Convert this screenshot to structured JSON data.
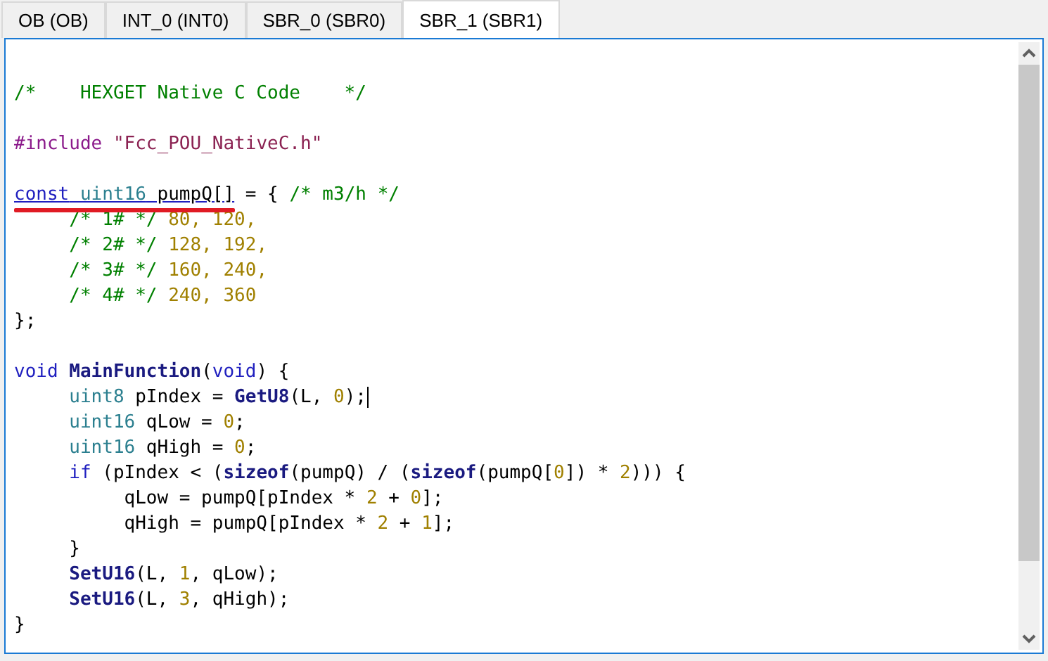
{
  "tabs": [
    {
      "label": "OB (OB)",
      "selected": false
    },
    {
      "label": "INT_0 (INT0)",
      "selected": false
    },
    {
      "label": "SBR_0 (SBR0)",
      "selected": false
    },
    {
      "label": "SBR_1 (SBR1)",
      "selected": true
    }
  ],
  "editor": {
    "lines": [
      {
        "kind": "blank"
      },
      {
        "kind": "code",
        "tokens": [
          {
            "text": "/*    HEXGET Native C Code    */",
            "kind": "comment"
          }
        ]
      },
      {
        "kind": "blank"
      },
      {
        "kind": "code",
        "tokens": [
          {
            "text": "#include",
            "kind": "directive"
          },
          {
            "text": " \"Fcc_POU_NativeC.h\"",
            "kind": "string"
          }
        ]
      },
      {
        "kind": "blank"
      },
      {
        "kind": "code",
        "marked": true,
        "tokens": [
          {
            "text": "const",
            "kind": "keyword",
            "underline": true
          },
          {
            "text": " uint16",
            "kind": "type",
            "underline": true
          },
          {
            "text": " pumpQ[]",
            "kind": "plain",
            "underline": true
          },
          {
            "text": " = {",
            "kind": "plain"
          },
          {
            "text": " /* m3/h */",
            "kind": "comment"
          }
        ]
      },
      {
        "kind": "code",
        "tokens": [
          {
            "text": "     /* 1# */",
            "kind": "comment"
          },
          {
            "text": " 80, 120,",
            "kind": "number"
          }
        ]
      },
      {
        "kind": "code",
        "tokens": [
          {
            "text": "     /* 2# */",
            "kind": "comment"
          },
          {
            "text": " 128, 192,",
            "kind": "number"
          }
        ]
      },
      {
        "kind": "code",
        "tokens": [
          {
            "text": "     /* 3# */",
            "kind": "comment"
          },
          {
            "text": " 160, 240,",
            "kind": "number"
          }
        ]
      },
      {
        "kind": "code",
        "tokens": [
          {
            "text": "     /* 4# */",
            "kind": "comment"
          },
          {
            "text": " 240, 360",
            "kind": "number"
          }
        ]
      },
      {
        "kind": "code",
        "tokens": [
          {
            "text": "};",
            "kind": "plain"
          }
        ]
      },
      {
        "kind": "blank"
      },
      {
        "kind": "code",
        "tokens": [
          {
            "text": "void",
            "kind": "keyword"
          },
          {
            "text": " MainFunction",
            "kind": "function"
          },
          {
            "text": "(",
            "kind": "plain"
          },
          {
            "text": "void",
            "kind": "keyword"
          },
          {
            "text": ") {",
            "kind": "plain"
          }
        ]
      },
      {
        "kind": "code",
        "cursor": true,
        "tokens": [
          {
            "text": "     uint8",
            "kind": "type"
          },
          {
            "text": " pIndex =",
            "kind": "plain"
          },
          {
            "text": " GetU8",
            "kind": "function"
          },
          {
            "text": "(L,",
            "kind": "plain"
          },
          {
            "text": " 0",
            "kind": "number"
          },
          {
            "text": ");",
            "kind": "plain"
          }
        ]
      },
      {
        "kind": "code",
        "tokens": [
          {
            "text": "     uint16",
            "kind": "type"
          },
          {
            "text": " qLow =",
            "kind": "plain"
          },
          {
            "text": " 0",
            "kind": "number"
          },
          {
            "text": ";",
            "kind": "plain"
          }
        ]
      },
      {
        "kind": "code",
        "tokens": [
          {
            "text": "     uint16",
            "kind": "type"
          },
          {
            "text": " qHigh =",
            "kind": "plain"
          },
          {
            "text": " 0",
            "kind": "number"
          },
          {
            "text": ";",
            "kind": "plain"
          }
        ]
      },
      {
        "kind": "code",
        "tokens": [
          {
            "text": "     if",
            "kind": "keyword"
          },
          {
            "text": " (pIndex < (",
            "kind": "plain"
          },
          {
            "text": "sizeof",
            "kind": "function"
          },
          {
            "text": "(pumpQ) / (",
            "kind": "plain"
          },
          {
            "text": "sizeof",
            "kind": "function"
          },
          {
            "text": "(pumpQ[",
            "kind": "plain"
          },
          {
            "text": "0",
            "kind": "number"
          },
          {
            "text": "]) *",
            "kind": "plain"
          },
          {
            "text": " 2",
            "kind": "number"
          },
          {
            "text": "))) {",
            "kind": "plain"
          }
        ]
      },
      {
        "kind": "code",
        "tokens": [
          {
            "text": "          qLow = pumpQ[pIndex *",
            "kind": "plain"
          },
          {
            "text": " 2",
            "kind": "number"
          },
          {
            "text": " +",
            "kind": "plain"
          },
          {
            "text": " 0",
            "kind": "number"
          },
          {
            "text": "];",
            "kind": "plain"
          }
        ]
      },
      {
        "kind": "code",
        "tokens": [
          {
            "text": "          qHigh = pumpQ[pIndex *",
            "kind": "plain"
          },
          {
            "text": " 2",
            "kind": "number"
          },
          {
            "text": " +",
            "kind": "plain"
          },
          {
            "text": " 1",
            "kind": "number"
          },
          {
            "text": "];",
            "kind": "plain"
          }
        ]
      },
      {
        "kind": "code",
        "tokens": [
          {
            "text": "     }",
            "kind": "plain"
          }
        ]
      },
      {
        "kind": "code",
        "tokens": [
          {
            "text": "     SetU16",
            "kind": "function"
          },
          {
            "text": "(L,",
            "kind": "plain"
          },
          {
            "text": " 1",
            "kind": "number"
          },
          {
            "text": ", qLow);",
            "kind": "plain"
          }
        ]
      },
      {
        "kind": "code",
        "tokens": [
          {
            "text": "     SetU16",
            "kind": "function"
          },
          {
            "text": "(L,",
            "kind": "plain"
          },
          {
            "text": " 3",
            "kind": "number"
          },
          {
            "text": ", qHigh);",
            "kind": "plain"
          }
        ]
      },
      {
        "kind": "code",
        "tokens": [
          {
            "text": "}",
            "kind": "plain"
          }
        ]
      }
    ]
  }
}
